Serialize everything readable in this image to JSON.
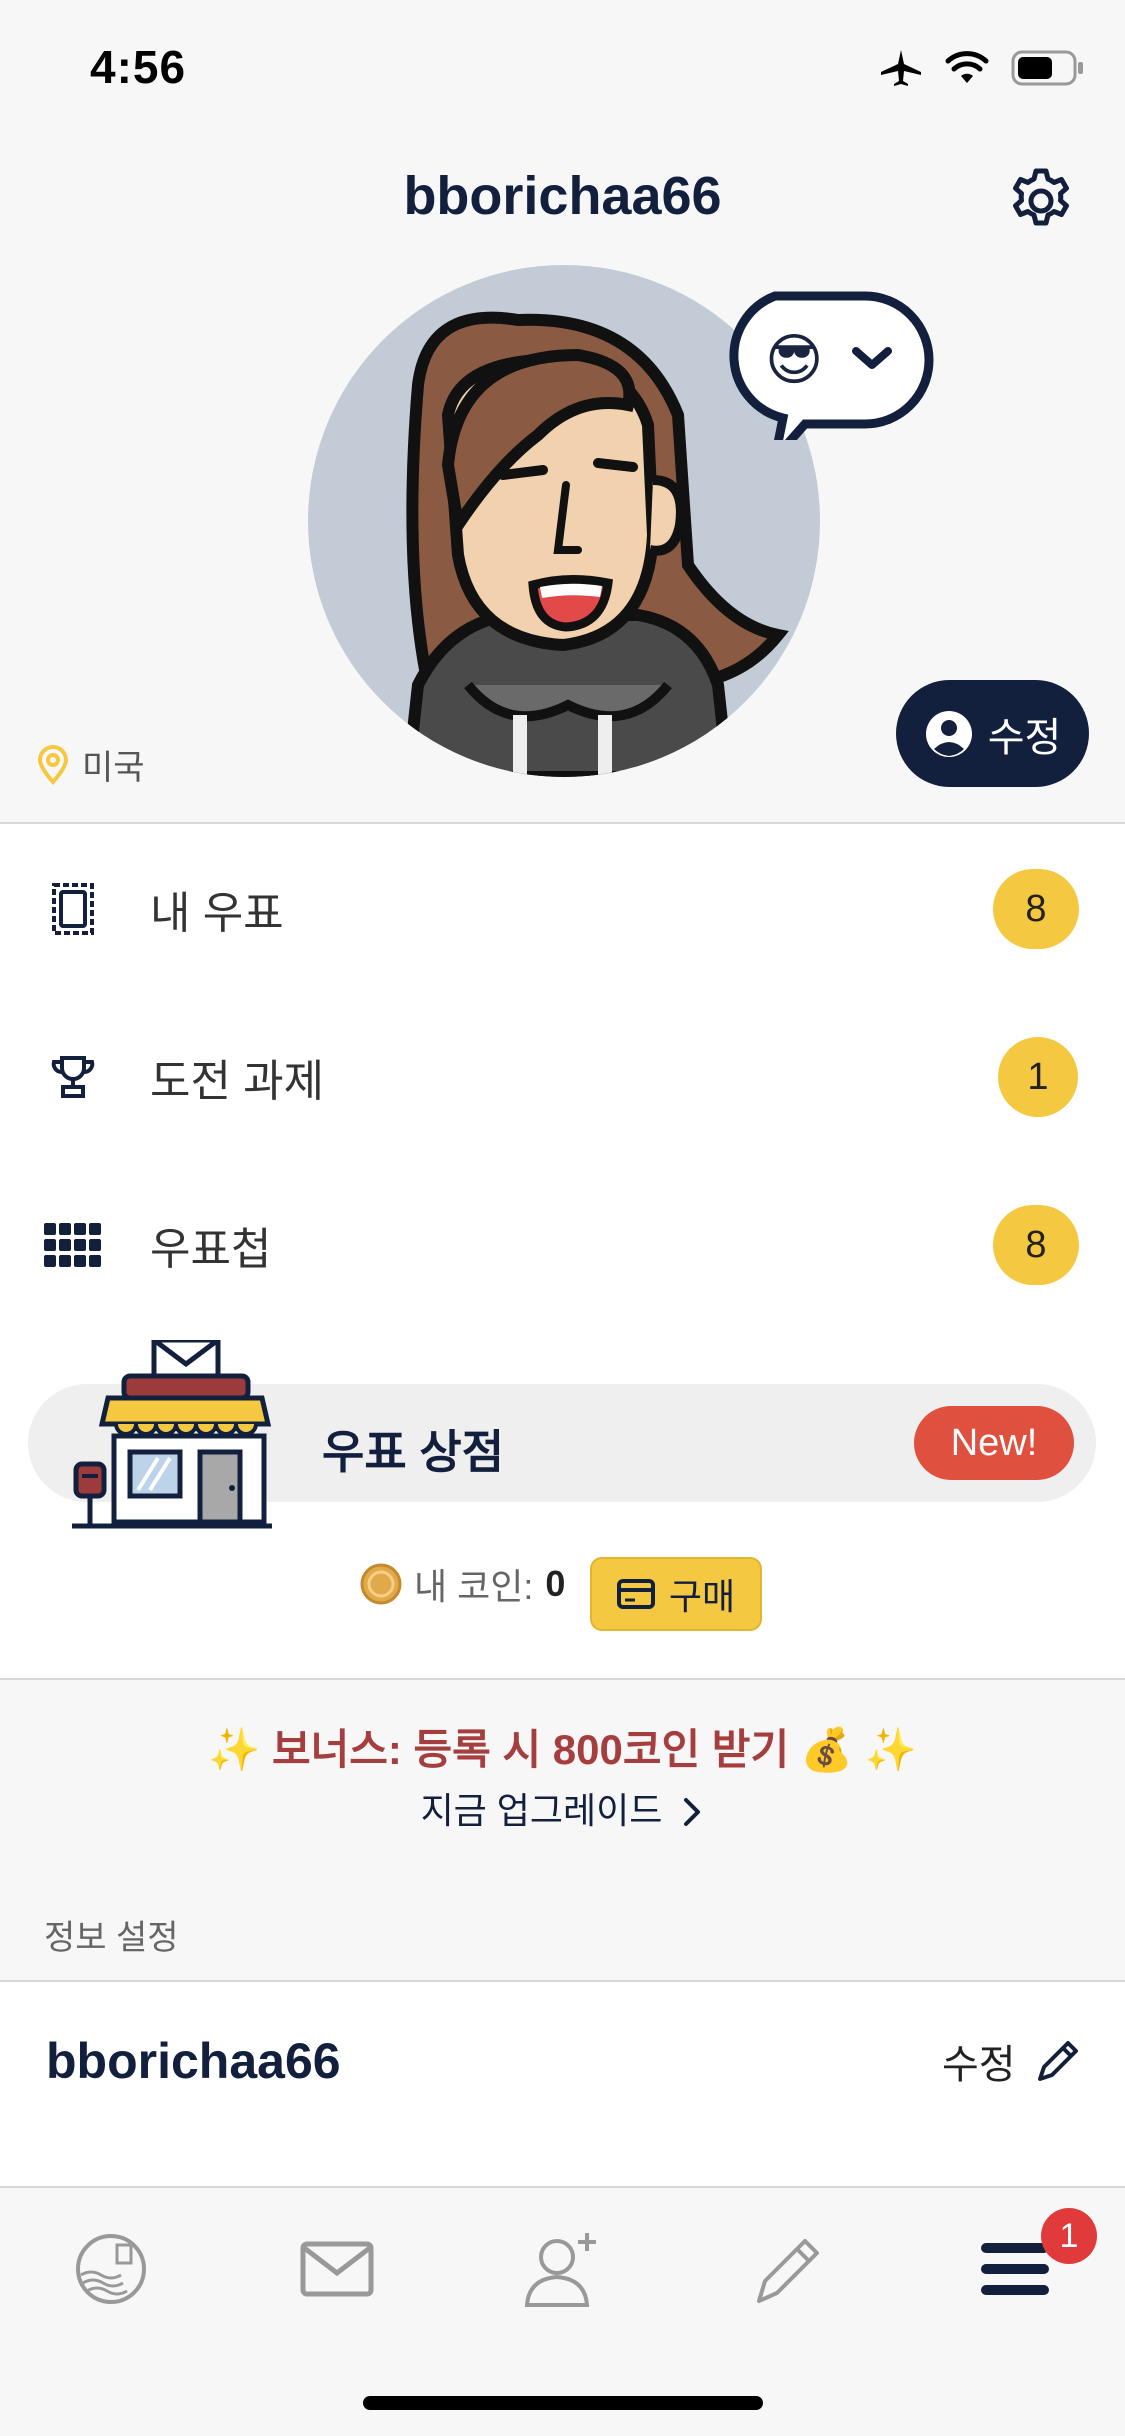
{
  "status_bar": {
    "time": "4:56"
  },
  "header": {
    "title": "bborichaa66"
  },
  "profile": {
    "location": "미국",
    "edit_label": "수정",
    "mood_emoji": "😎"
  },
  "menu": {
    "items": [
      {
        "label": "내 우표",
        "count": "8",
        "icon": "stamp-icon"
      },
      {
        "label": "도전 과제",
        "count": "1",
        "icon": "trophy-icon"
      },
      {
        "label": "우표첩",
        "count": "8",
        "icon": "grid-icon"
      }
    ]
  },
  "shop": {
    "label": "우표 상점",
    "new_badge": "New!",
    "coins_label": "내 코인:",
    "coins_value": "0",
    "buy_label": "구매"
  },
  "bonus": {
    "text": "✨ 보너스: 등록 시 800코인 받기 💰 ✨",
    "upgrade_link": "지금 업그레이드"
  },
  "info": {
    "section_label": "정보 설정",
    "username": "bborichaa66",
    "edit_label": "수정"
  },
  "tabbar": {
    "tabs": [
      "stamp-globe-icon",
      "mail-icon",
      "add-friend-icon",
      "pencil-icon",
      "menu-icon"
    ],
    "notification_count": "1"
  },
  "colors": {
    "navy": "#13203d",
    "badge_yellow": "#f5c842",
    "new_red": "#e0503f",
    "bonus_red": "#a53f3f",
    "notification_red": "#e03a3a"
  }
}
